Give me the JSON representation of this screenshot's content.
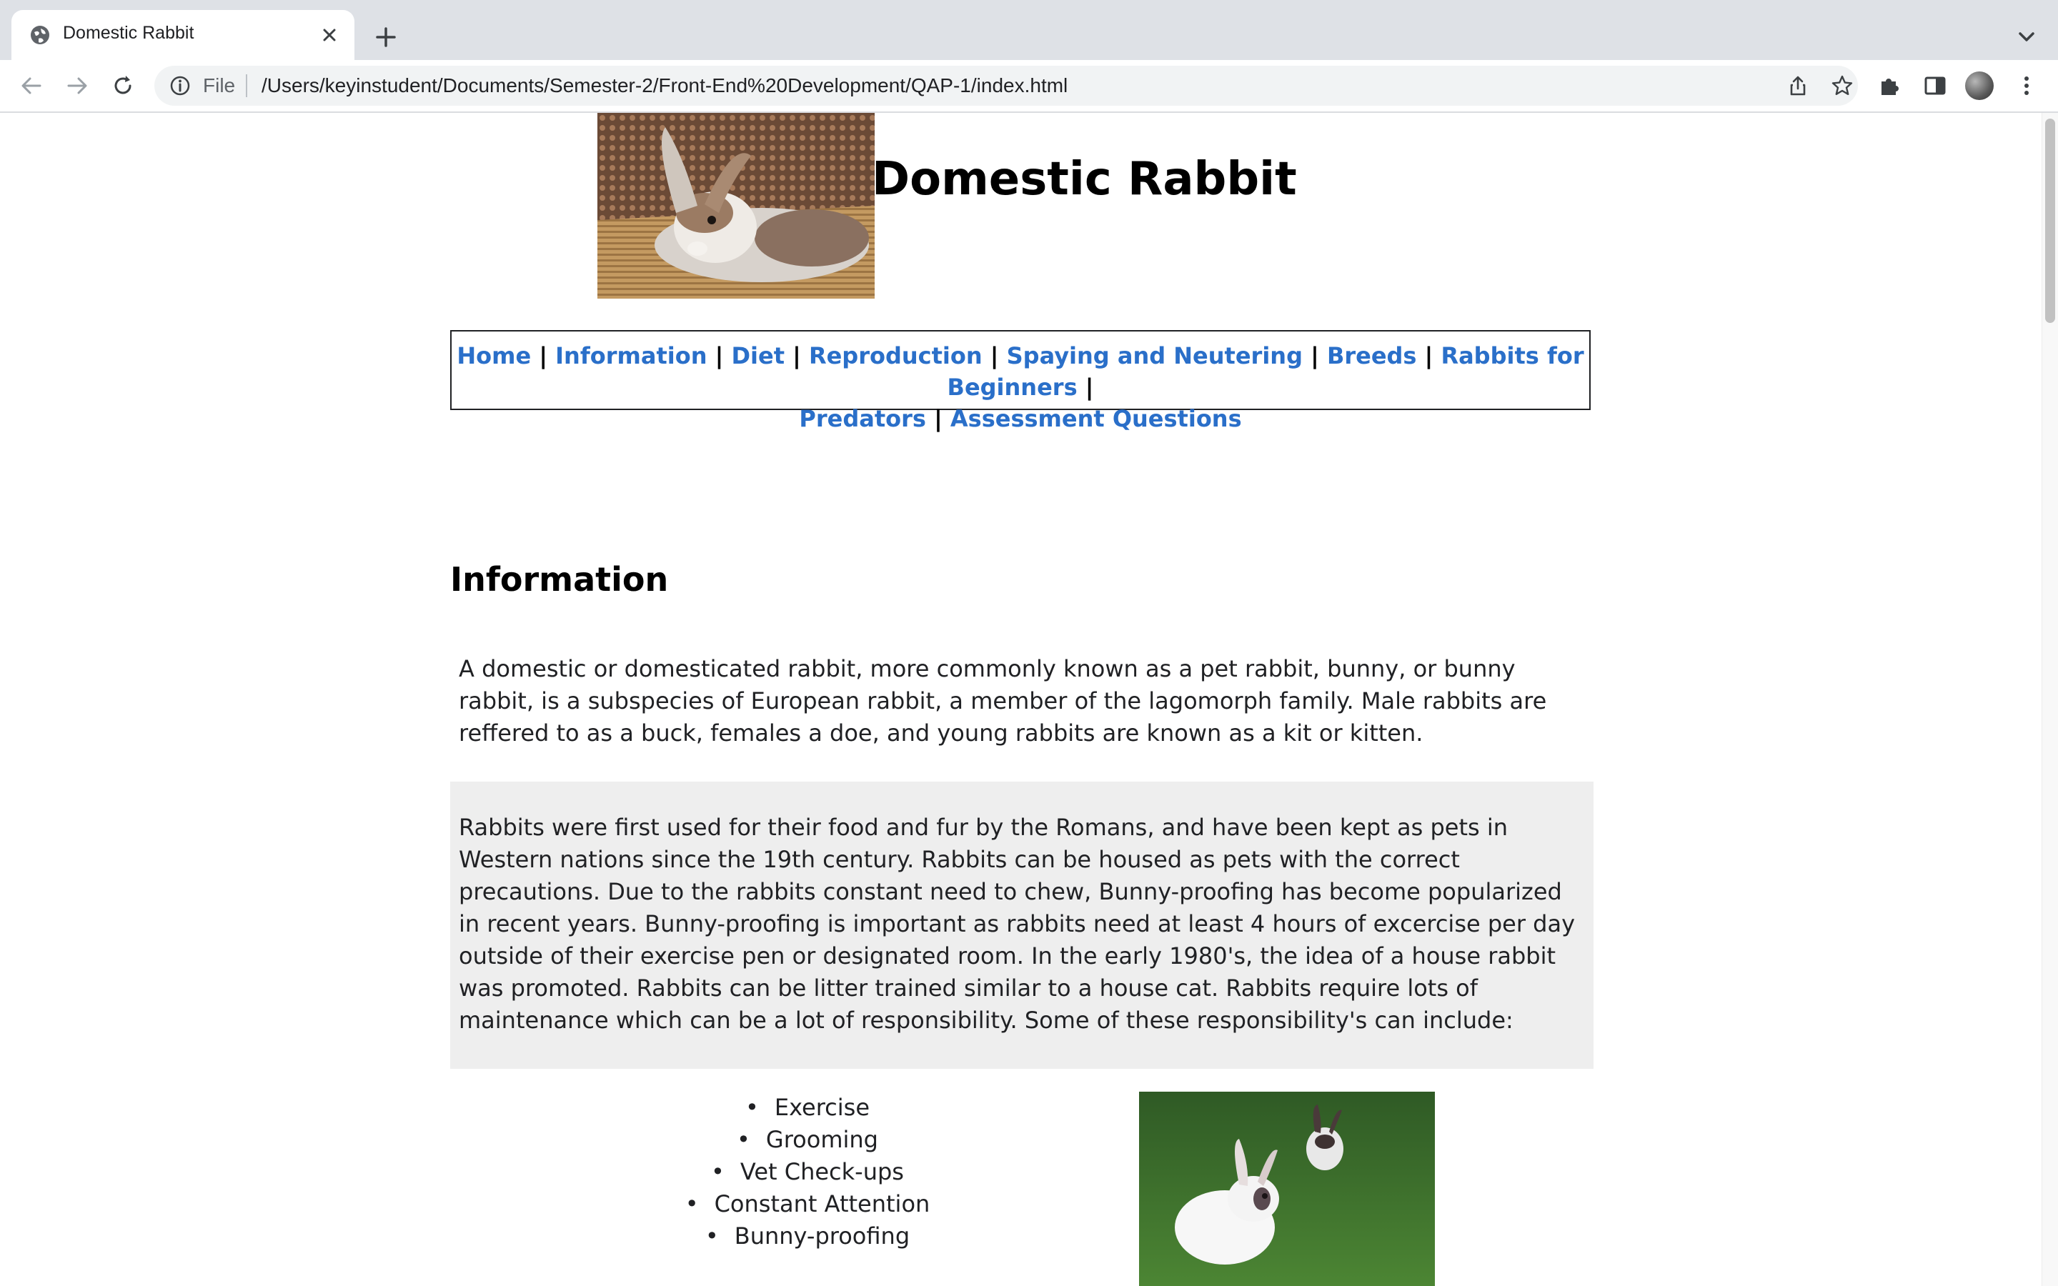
{
  "browser": {
    "tab_title": "Domestic Rabbit",
    "omnibox_scheme": "File",
    "url": "/Users/keyinstudent/Documents/Semester-2/Front-End%20Development/QAP-1/index.html"
  },
  "page": {
    "site_title": "Domestic Rabbit",
    "header_image_icon": "rabbit-photo",
    "nav": {
      "items": [
        {
          "label": "Home"
        },
        {
          "label": "Information"
        },
        {
          "label": "Diet"
        },
        {
          "label": "Reproduction"
        },
        {
          "label": "Spaying and Neutering"
        },
        {
          "label": "Breeds"
        },
        {
          "label": "Rabbits for Beginners"
        },
        {
          "label": "Predators"
        },
        {
          "label": "Assessment Questions"
        }
      ],
      "separator": "|",
      "link_color": "#2a6fc9"
    },
    "section_title": "Information",
    "paragraph1": "A domestic or domesticated rabbit, more commonly known as a pet rabbit, bunny, or bunny rabbit, is a subspecies of European rabbit, a member of the lagomorph family. Male rabbits are reffered to as a buck, females a doe, and young rabbits are known as a kit or kitten.",
    "paragraph2": "Rabbits were first used for their food and fur by the Romans, and have been kept as pets in Western nations since the 19th century. Rabbits can be housed as pets with the correct precautions. Due to the rabbits constant need to chew, Bunny-proofing has become popularized in recent years. Bunny-proofing is important as rabbits need at least 4 hours of excercise per day outside of their exercise pen or designated room. In the early 1980's, the idea of a house rabbit was promoted. Rabbits can be litter trained similar to a house cat. Rabbits require lots of maintenance which can be a lot of responsibility. Some of these responsibility's can include:",
    "responsibilities": [
      "Exercise",
      "Grooming",
      "Vet Check-ups",
      "Constant Attention",
      "Bunny-proofing"
    ],
    "paragraph2_background": "#eeeeee"
  }
}
